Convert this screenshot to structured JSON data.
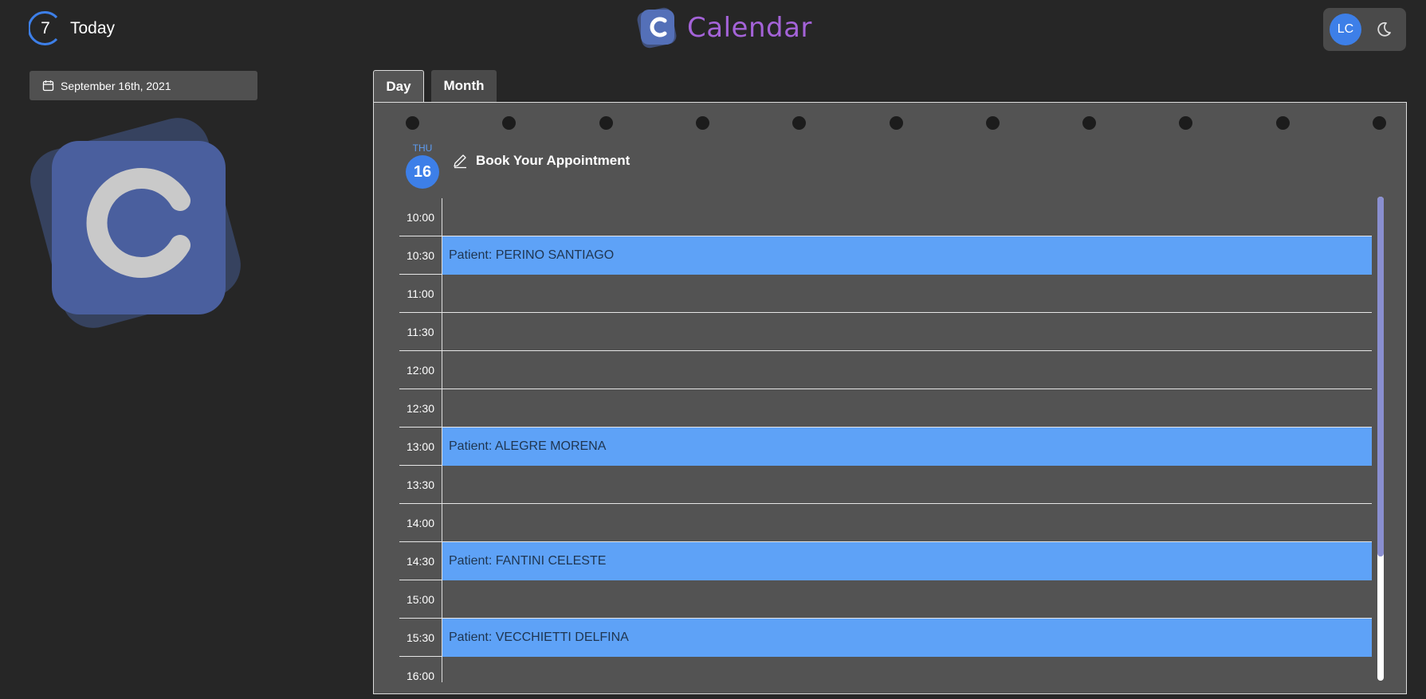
{
  "header": {
    "today_number": "7",
    "today_label": "Today",
    "brand_letter": "C",
    "brand_name": "Calendar",
    "user_initials": "LC"
  },
  "sidebar": {
    "selected_date": "September 16th, 2021",
    "logo_letter": "C"
  },
  "tabs": [
    {
      "label": "Day",
      "active": true
    },
    {
      "label": "Month",
      "active": false
    }
  ],
  "day_view": {
    "day_name": "THU",
    "day_number": "16",
    "book_label": "Book Your Appointment",
    "slots": [
      {
        "time": "10:00",
        "appointment": ""
      },
      {
        "time": "10:30",
        "appointment": "Patient: PERINO SANTIAGO"
      },
      {
        "time": "11:00",
        "appointment": ""
      },
      {
        "time": "11:30",
        "appointment": ""
      },
      {
        "time": "12:00",
        "appointment": ""
      },
      {
        "time": "12:30",
        "appointment": ""
      },
      {
        "time": "13:00",
        "appointment": "Patient: ALEGRE MORENA"
      },
      {
        "time": "13:30",
        "appointment": ""
      },
      {
        "time": "14:00",
        "appointment": ""
      },
      {
        "time": "14:30",
        "appointment": "Patient: FANTINI CELESTE"
      },
      {
        "time": "15:00",
        "appointment": ""
      },
      {
        "time": "15:30",
        "appointment": "Patient: VECCHIETTI DELFINA"
      },
      {
        "time": "16:00",
        "appointment": ""
      }
    ]
  },
  "colors": {
    "accent": "#3d7fe8",
    "appointment": "#5ea2f7",
    "brand_text": "#a463d8",
    "background": "#262626",
    "panel": "#535353"
  }
}
